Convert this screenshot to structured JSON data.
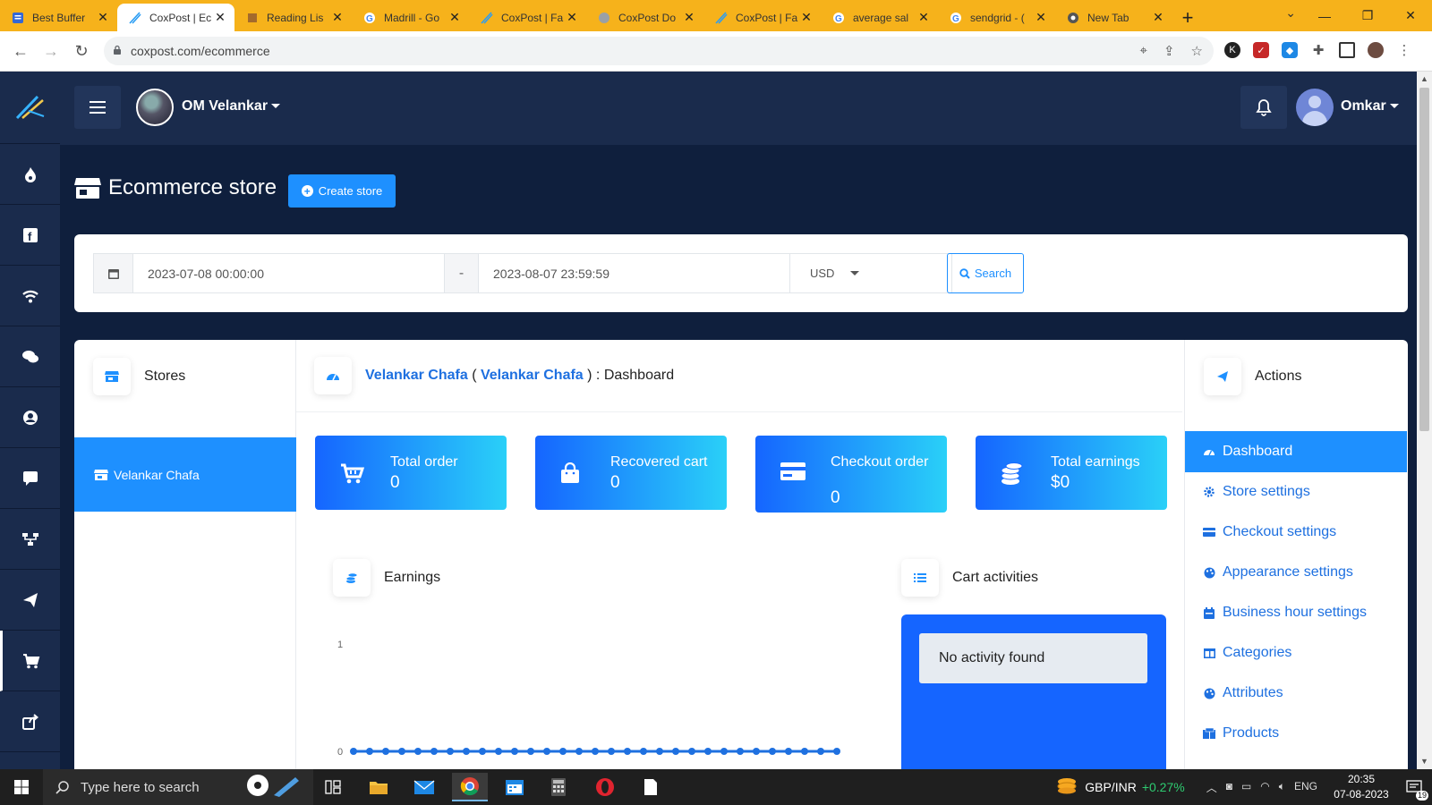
{
  "browser": {
    "tabs": [
      {
        "title": "Best Buffer",
        "active": false
      },
      {
        "title": "CoxPost | Ec",
        "active": true
      },
      {
        "title": "Reading Lis",
        "active": false
      },
      {
        "title": "Madrill - Go",
        "active": false
      },
      {
        "title": "CoxPost | Fa",
        "active": false
      },
      {
        "title": "CoxPost Do",
        "active": false
      },
      {
        "title": "CoxPost | Fa",
        "active": false
      },
      {
        "title": "average sal",
        "active": false
      },
      {
        "title": "sendgrid - (",
        "active": false
      },
      {
        "title": "New Tab",
        "active": false
      }
    ],
    "new_tab_label": "+",
    "url": "coxpost.com/ecommerce",
    "colors": {
      "tab_strip": "#f6b21b"
    }
  },
  "header": {
    "account_name": "OM Velankar",
    "user_name": "Omkar"
  },
  "page": {
    "title": "Ecommerce store",
    "create_button_label": "Create store"
  },
  "filter": {
    "start_date": "2023-07-08 00:00:00",
    "separator": "-",
    "end_date": "2023-08-07 23:59:59",
    "currency": "USD",
    "search_label": "Search"
  },
  "stores": {
    "title": "Stores",
    "items": [
      {
        "label": "Velankar Chafa",
        "selected": true
      }
    ]
  },
  "dashboard": {
    "store_name": "Velankar Chafa",
    "open_paren": "(",
    "store_link": "Velankar Chafa",
    "suffix": ") : Dashboard",
    "stats": [
      {
        "label": "Total order",
        "value": "0",
        "icon": "cart-icon"
      },
      {
        "label": "Recovered cart",
        "value": "0",
        "icon": "bag-icon"
      },
      {
        "label": "Checkout order",
        "value": "0",
        "icon": "credit-card-icon"
      },
      {
        "label": "Total earnings",
        "value": "$0",
        "icon": "coins-icon"
      }
    ],
    "earnings_title": "Earnings",
    "cart_activities_title": "Cart activities",
    "no_activity_text": "No activity found"
  },
  "chart_data": {
    "type": "line",
    "title": "Earnings",
    "ylim": [
      0,
      1
    ],
    "y_ticks": [
      "1",
      "0"
    ],
    "points": 31,
    "values": [
      0,
      0,
      0,
      0,
      0,
      0,
      0,
      0,
      0,
      0,
      0,
      0,
      0,
      0,
      0,
      0,
      0,
      0,
      0,
      0,
      0,
      0,
      0,
      0,
      0,
      0,
      0,
      0,
      0,
      0,
      0
    ],
    "color": "#1e70e0"
  },
  "actions": {
    "title": "Actions",
    "items": [
      {
        "label": "Dashboard",
        "icon": "gauge-icon",
        "active": true
      },
      {
        "label": "Store settings",
        "icon": "gear-icon",
        "active": false
      },
      {
        "label": "Checkout settings",
        "icon": "credit-card-icon",
        "active": false
      },
      {
        "label": "Appearance settings",
        "icon": "palette-icon",
        "active": false
      },
      {
        "label": "Business hour settings",
        "icon": "calendar-icon",
        "active": false
      },
      {
        "label": "Categories",
        "icon": "columns-icon",
        "active": false
      },
      {
        "label": "Attributes",
        "icon": "palette-icon",
        "active": false
      },
      {
        "label": "Products",
        "icon": "boxes-icon",
        "active": false
      }
    ]
  },
  "taskbar": {
    "search_placeholder": "Type here to search",
    "ticker_pair": "GBP/INR",
    "ticker_change": "+0.27%",
    "language": "ENG",
    "time": "20:35",
    "date": "07-08-2023",
    "notification_count": "19"
  },
  "colors": {
    "primary": "#1e90ff",
    "sidebar": "#1a2b4c",
    "page_bg": "#0f1f3d"
  }
}
